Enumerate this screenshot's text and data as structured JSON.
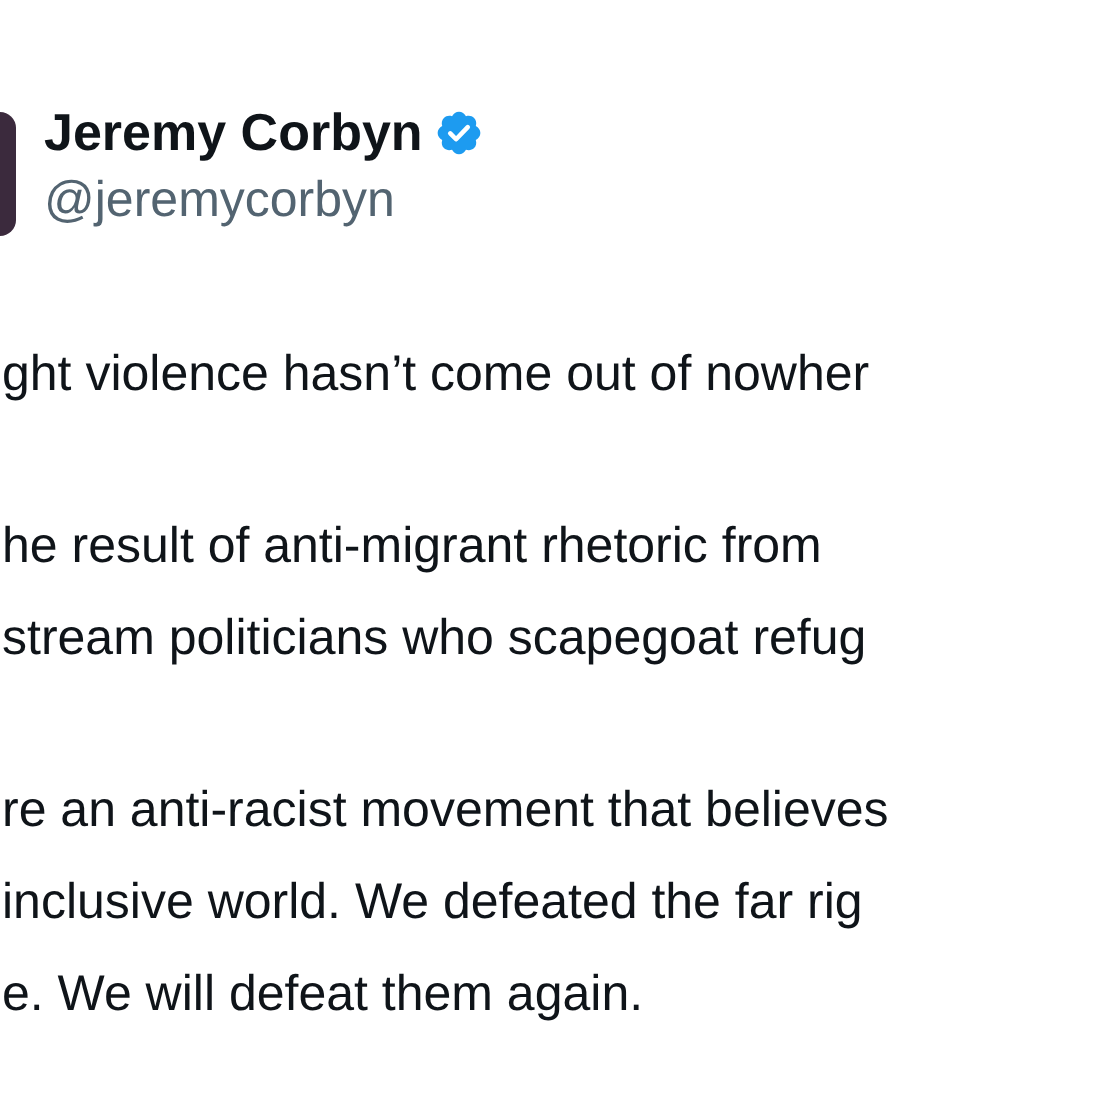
{
  "post": {
    "author": {
      "name": "Jeremy Corbyn",
      "verified": true,
      "handle": "@jeremycorbyn"
    },
    "paragraphs": [
      [
        "ght violence hasn’t come out of nowher"
      ],
      [
        "he result of anti-migrant rhetoric from",
        "stream politicians who scapegoat refug"
      ],
      [
        "re an anti-racist movement that believes",
        "inclusive world. We defeated the far rig",
        "e. We will defeat them again."
      ]
    ]
  }
}
